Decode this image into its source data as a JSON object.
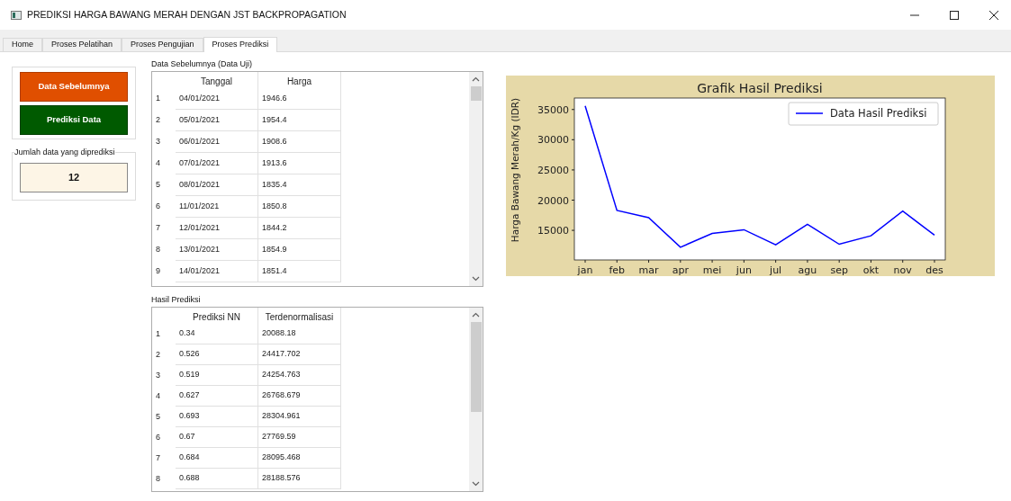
{
  "window": {
    "title": "PREDIKSI HARGA BAWANG MERAH DENGAN JST BACKPROPAGATION"
  },
  "tabs": [
    {
      "label": "Home",
      "selected": false
    },
    {
      "label": "Proses Pelatihan",
      "selected": false
    },
    {
      "label": "Proses Pengujian",
      "selected": false
    },
    {
      "label": "Proses Prediksi",
      "selected": true
    }
  ],
  "buttons": [
    {
      "label": "Data Sebelumnya",
      "kind": "orange"
    },
    {
      "label": "Prediksi Data",
      "kind": "green"
    }
  ],
  "count_group": {
    "label": "Jumlah data yang diprediksi",
    "value": "12"
  },
  "previous_table": {
    "label": "Data Sebelumnya (Data Uji)",
    "columns": [
      "Tanggal",
      "Harga"
    ],
    "rows": [
      {
        "index": "1",
        "cells": [
          "04/01/2021",
          "1946.6"
        ]
      },
      {
        "index": "2",
        "cells": [
          "05/01/2021",
          "1954.4"
        ]
      },
      {
        "index": "3",
        "cells": [
          "06/01/2021",
          "1908.6"
        ]
      },
      {
        "index": "4",
        "cells": [
          "07/01/2021",
          "1913.6"
        ]
      },
      {
        "index": "5",
        "cells": [
          "08/01/2021",
          "1835.4"
        ]
      },
      {
        "index": "6",
        "cells": [
          "11/01/2021",
          "1850.8"
        ]
      },
      {
        "index": "7",
        "cells": [
          "12/01/2021",
          "1844.2"
        ]
      },
      {
        "index": "8",
        "cells": [
          "13/01/2021",
          "1854.9"
        ]
      },
      {
        "index": "9",
        "cells": [
          "14/01/2021",
          "1851.4"
        ]
      }
    ]
  },
  "result_table": {
    "label": "Hasil Prediksi",
    "columns": [
      "Prediksi NN",
      "Terdenormalisasi"
    ],
    "rows": [
      {
        "index": "1",
        "cells": [
          "0.34",
          "20088.18"
        ]
      },
      {
        "index": "2",
        "cells": [
          "0.526",
          "24417.702"
        ]
      },
      {
        "index": "3",
        "cells": [
          "0.519",
          "24254.763"
        ]
      },
      {
        "index": "4",
        "cells": [
          "0.627",
          "26768.679"
        ]
      },
      {
        "index": "5",
        "cells": [
          "0.693",
          "28304.961"
        ]
      },
      {
        "index": "6",
        "cells": [
          "0.67",
          "27769.59"
        ]
      },
      {
        "index": "7",
        "cells": [
          "0.684",
          "28095.468"
        ]
      },
      {
        "index": "8",
        "cells": [
          "0.688",
          "28188.576"
        ]
      }
    ]
  },
  "chart": {
    "chart_data": {
      "type": "line",
      "title": "Grafik Hasil Prediksi",
      "ylabel": "Harga Bawang Merah/Kg (IDR)",
      "categories": [
        "jan",
        "feb",
        "mar",
        "apr",
        "mei",
        "jun",
        "jul",
        "agu",
        "sep",
        "okt",
        "nov",
        "des"
      ],
      "series": [
        {
          "name": "Data Hasil Prediksi",
          "color": "#0000ff",
          "values": [
            35600,
            18300,
            17100,
            12200,
            14500,
            15100,
            12600,
            16000,
            12700,
            14100,
            18200,
            14200
          ]
        }
      ],
      "ylim": [
        10100,
        36900
      ],
      "yticks": [
        15000,
        20000,
        25000,
        30000,
        35000
      ]
    }
  }
}
